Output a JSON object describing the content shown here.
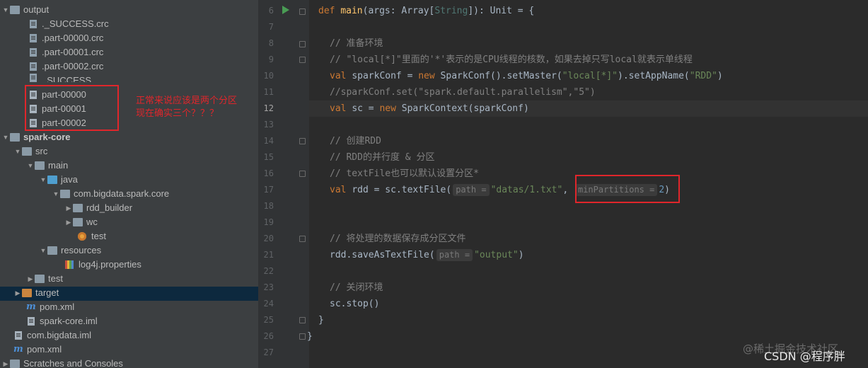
{
  "project_tree": {
    "items": [
      {
        "label": "output"
      },
      {
        "label": "._SUCCESS.crc"
      },
      {
        "label": ".part-00000.crc"
      },
      {
        "label": ".part-00001.crc"
      },
      {
        "label": ".part-00002.crc"
      },
      {
        "label": "_SUCCESS"
      },
      {
        "label": "part-00000"
      },
      {
        "label": "part-00001"
      },
      {
        "label": "part-00002"
      },
      {
        "label": "spark-core"
      },
      {
        "label": "src"
      },
      {
        "label": "main"
      },
      {
        "label": "java"
      },
      {
        "label": "com.bigdata.spark.core"
      },
      {
        "label": "rdd_builder"
      },
      {
        "label": "wc"
      },
      {
        "label": "test"
      },
      {
        "label": "resources"
      },
      {
        "label": "log4j.properties"
      },
      {
        "label": "test"
      },
      {
        "label": "target"
      },
      {
        "label": "pom.xml"
      },
      {
        "label": "spark-core.iml"
      },
      {
        "label": "com.bigdata.iml"
      },
      {
        "label": "pom.xml"
      },
      {
        "label": "Scratches and Consoles"
      }
    ]
  },
  "annotation": {
    "line1": "正常来说应该是两个分区",
    "line2": "现在确实三个？？？"
  },
  "editor": {
    "line_numbers": [
      "6",
      "7",
      "8",
      "9",
      "10",
      "11",
      "12",
      "13",
      "14",
      "15",
      "16",
      "17",
      "18",
      "19",
      "20",
      "21",
      "22",
      "23",
      "24",
      "25",
      "26",
      "27"
    ],
    "current_line": "12",
    "l6": {
      "def": "def ",
      "main": "main",
      "a": "(args: Array[",
      "string": "String",
      "b": "]): Unit = {"
    },
    "l8": {
      "comment": "// 准备环境"
    },
    "l9": {
      "comment": "// \"local[*]\"里面的'*'表示的是CPU线程的核数，如果去掉只写local就表示单线程"
    },
    "l10": {
      "val": "val ",
      "a": "sparkConf = ",
      "new": "new ",
      "b": "SparkConf().setMaster(",
      "s1": "\"local[*]\"",
      "c": ").setAppName(",
      "s2": "\"RDD\"",
      "d": ")"
    },
    "l11": {
      "comment": "//sparkConf.set(\"spark.default.parallelism\",\"5\")"
    },
    "l12": {
      "val": "val ",
      "a": "sc = ",
      "new": "new ",
      "b": "SparkContext(sparkConf)"
    },
    "l14": {
      "comment": "// 创建RDD"
    },
    "l15": {
      "comment": "// RDD的并行度 & 分区"
    },
    "l16": {
      "comment": "// textFile也可以默认设置分区*"
    },
    "l17": {
      "val": "val ",
      "a": "rdd = sc.textFile(",
      "hint1": "path =",
      "s1": "\"datas/1.txt\"",
      "b": ", ",
      "hint2": "minPartitions =",
      "n": "2",
      "c": ")"
    },
    "l20": {
      "comment": "// 将处理的数据保存成分区文件"
    },
    "l21": {
      "a": "rdd.saveAsTextFile(",
      "hint": "path =",
      "s": "\"output\"",
      "b": ")"
    },
    "l23": {
      "comment": "// 关闭环境"
    },
    "l24": {
      "a": "sc.stop()"
    },
    "l25": {
      "a": "}"
    },
    "l26": {
      "a": "}"
    }
  },
  "watermark": {
    "site": "@稀土掘金技术社区",
    "author": "CSDN @程序胖"
  },
  "colors": {
    "annotation_red": "#e0262b",
    "keyword": "#cc7832",
    "string": "#6a8759",
    "number": "#6897bb",
    "comment": "#808080"
  }
}
